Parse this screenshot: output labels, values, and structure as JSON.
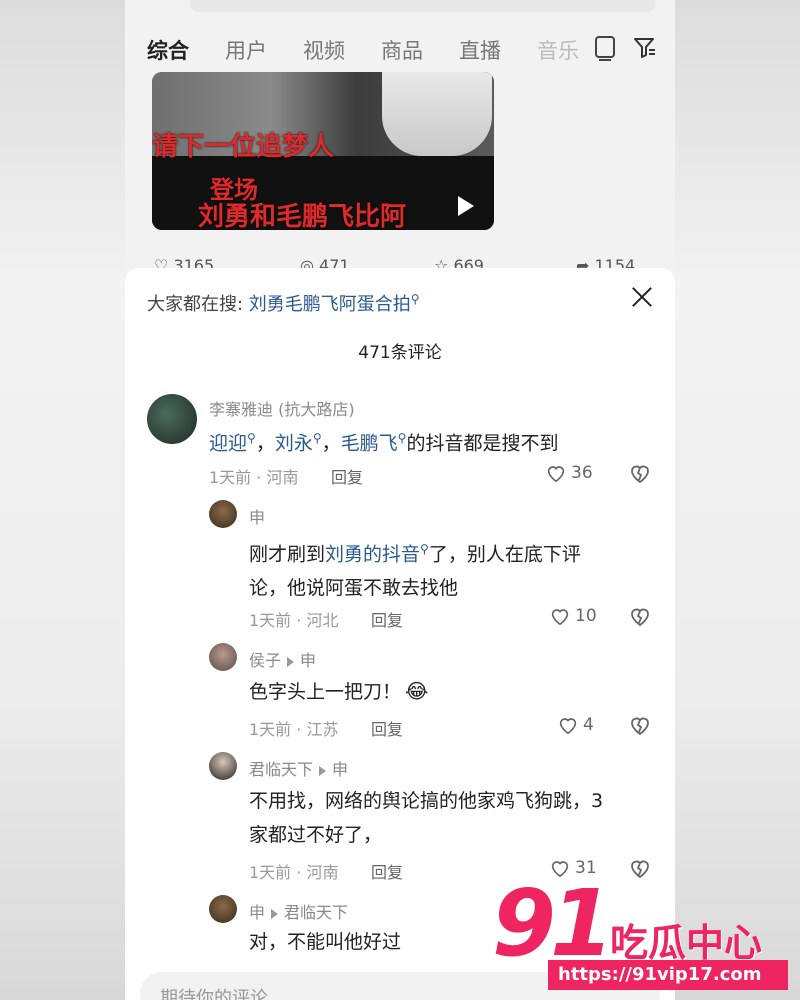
{
  "tabs": [
    {
      "label": "综合"
    },
    {
      "label": "用户"
    },
    {
      "label": "视频"
    },
    {
      "label": "商品"
    },
    {
      "label": "直播"
    },
    {
      "label": "音乐"
    }
  ],
  "video": {
    "line1": "请下一位追梦人",
    "line2": "登场",
    "line3": "刘勇和毛鹏飞比阿"
  },
  "stats": {
    "likes": "3165",
    "comments": "471",
    "favorites": "669",
    "shares": "1154"
  },
  "sheet": {
    "suggest_prefix": "大家都在搜: ",
    "suggest_link": "刘勇毛鹏飞阿蛋合拍",
    "count": "471条评论"
  },
  "comments": [
    {
      "user": "李寨雅迪 (抗大路店)",
      "links": [
        "迎迎",
        "刘永",
        "毛鹏飞"
      ],
      "sep": "，",
      "text_after": "的抖音都是搜不到",
      "meta": "1天前 · 河南",
      "reply": "回复",
      "likes": "36"
    },
    {
      "user": "申",
      "text_before": "刚才刷到",
      "link": "刘勇的抖音",
      "text_after_line1": "了，别人在底下评",
      "text_line2": "论，他说阿蛋不敢去找他",
      "meta": "1天前 · 河北",
      "reply": "回复",
      "likes": "10"
    },
    {
      "user": "侯子",
      "reply_to": "申",
      "text": "色字头上一把刀！",
      "emoji": "😂",
      "meta": "1天前 · 江苏",
      "reply": "回复",
      "likes": "4"
    },
    {
      "user": "君临天下",
      "reply_to": "申",
      "text_line1": "不用找，网络的舆论搞的他家鸡飞狗跳，3",
      "text_line2": "家都过不好了，",
      "meta": "1天前 · 河南",
      "reply": "回复",
      "likes": "31"
    },
    {
      "user": "申",
      "reply_to": "君临天下",
      "text": "对，不能叫他好过"
    }
  ],
  "input": {
    "placeholder": "期待你的评论"
  },
  "watermark": {
    "number": "91",
    "title": "吃瓜中心",
    "url": "https://91vip17.com"
  },
  "colors": {
    "link": "#2a5a93",
    "brand": "#ee2560"
  }
}
